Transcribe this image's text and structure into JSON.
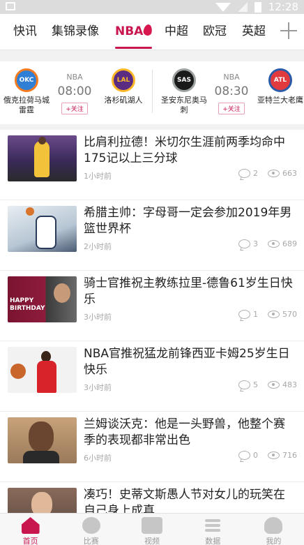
{
  "status_bar": {
    "time": "12:28"
  },
  "tabs": [
    {
      "label": "快讯"
    },
    {
      "label": "集锦录像"
    },
    {
      "label": "NBA"
    },
    {
      "label": "中超"
    },
    {
      "label": "欧冠"
    },
    {
      "label": "英超"
    }
  ],
  "active_tab": "NBA",
  "scores": [
    {
      "league": "NBA",
      "time": "08:00",
      "follow": "+关注",
      "home": {
        "abbr": "OKC",
        "name": "俄克拉荷马城雷霆"
      },
      "away": {
        "abbr": "LAL",
        "name": "洛杉矶湖人"
      }
    },
    {
      "league": "NBA",
      "time": "08:30",
      "follow": "+关注",
      "home": {
        "abbr": "SAS",
        "name": "圣安东尼奥马刺"
      },
      "away": {
        "abbr": "ATL",
        "name": "亚特兰大老鹰"
      }
    }
  ],
  "news": [
    {
      "title": "比肩利拉德！米切尔生涯前两季均命中175记以上三分球",
      "ago": "1小时前",
      "comments": "2",
      "views": "663"
    },
    {
      "title": "希腊主帅：字母哥一定会参加2019年男篮世界杯",
      "ago": "2小时前",
      "comments": "3",
      "views": "689"
    },
    {
      "title": "骑士官推祝主教练拉里-德鲁61岁生日快乐",
      "ago": "3小时前",
      "comments": "1",
      "views": "570",
      "thumb_text": "HAPPY BIRTHDAY"
    },
    {
      "title": "NBA官推祝猛龙前锋西亚卡姆25岁生日快乐",
      "ago": "3小时前",
      "comments": "5",
      "views": "483"
    },
    {
      "title": "兰姆谈沃克：他是一头野兽，他整个赛季的表现都非常出色",
      "ago": "6小时前",
      "comments": "0",
      "views": "716"
    },
    {
      "title": "凑巧！史蒂文斯愚人节对女儿的玩笑在自己身上成真",
      "ago": "",
      "comments": "",
      "views": ""
    }
  ],
  "bottom_nav": [
    {
      "label": "首页",
      "icon": "home-icon"
    },
    {
      "label": "比赛",
      "icon": "match-icon"
    },
    {
      "label": "视频",
      "icon": "video-icon"
    },
    {
      "label": "数据",
      "icon": "data-icon"
    },
    {
      "label": "我的",
      "icon": "me-icon"
    }
  ],
  "colors": {
    "accent": "#c8174f",
    "muted": "#a8a8a8"
  }
}
